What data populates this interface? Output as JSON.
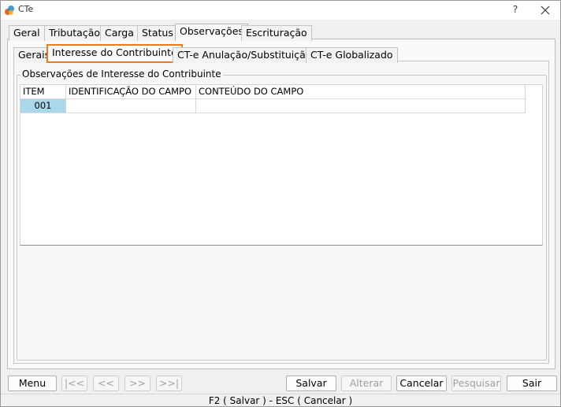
{
  "window": {
    "title": "CTe",
    "help_label": "?"
  },
  "main_tabs": [
    "Geral",
    "Tributação",
    "Carga",
    "Status",
    "Observações",
    "Escrituração"
  ],
  "sub_tabs": [
    "Gerais",
    "Interesse do Contribuinte",
    "CT-e Anulação/Substituição",
    "CT-e Globalizado"
  ],
  "group": {
    "title": "Observações de Interesse do Contribuinte"
  },
  "grid": {
    "headers": [
      "ITEM",
      "IDENTIFICAÇÃO DO CAMPO",
      "CONTEÚDO DO CAMPO"
    ],
    "rows": [
      {
        "item": "001",
        "ident": "",
        "content": ""
      }
    ]
  },
  "buttons": {
    "menu": "Menu",
    "first": "|<<",
    "prev": "<<",
    "next": ">>",
    "last": ">>|",
    "save": "Salvar",
    "edit": "Alterar",
    "cancel": "Cancelar",
    "search": "Pesquisar",
    "exit": "Sair"
  },
  "status_bar": "F2 ( Salvar )   -   ESC ( Cancelar )",
  "colors": {
    "focus_outline": "#f07a20",
    "selected_cell": "#a9d8ea"
  }
}
